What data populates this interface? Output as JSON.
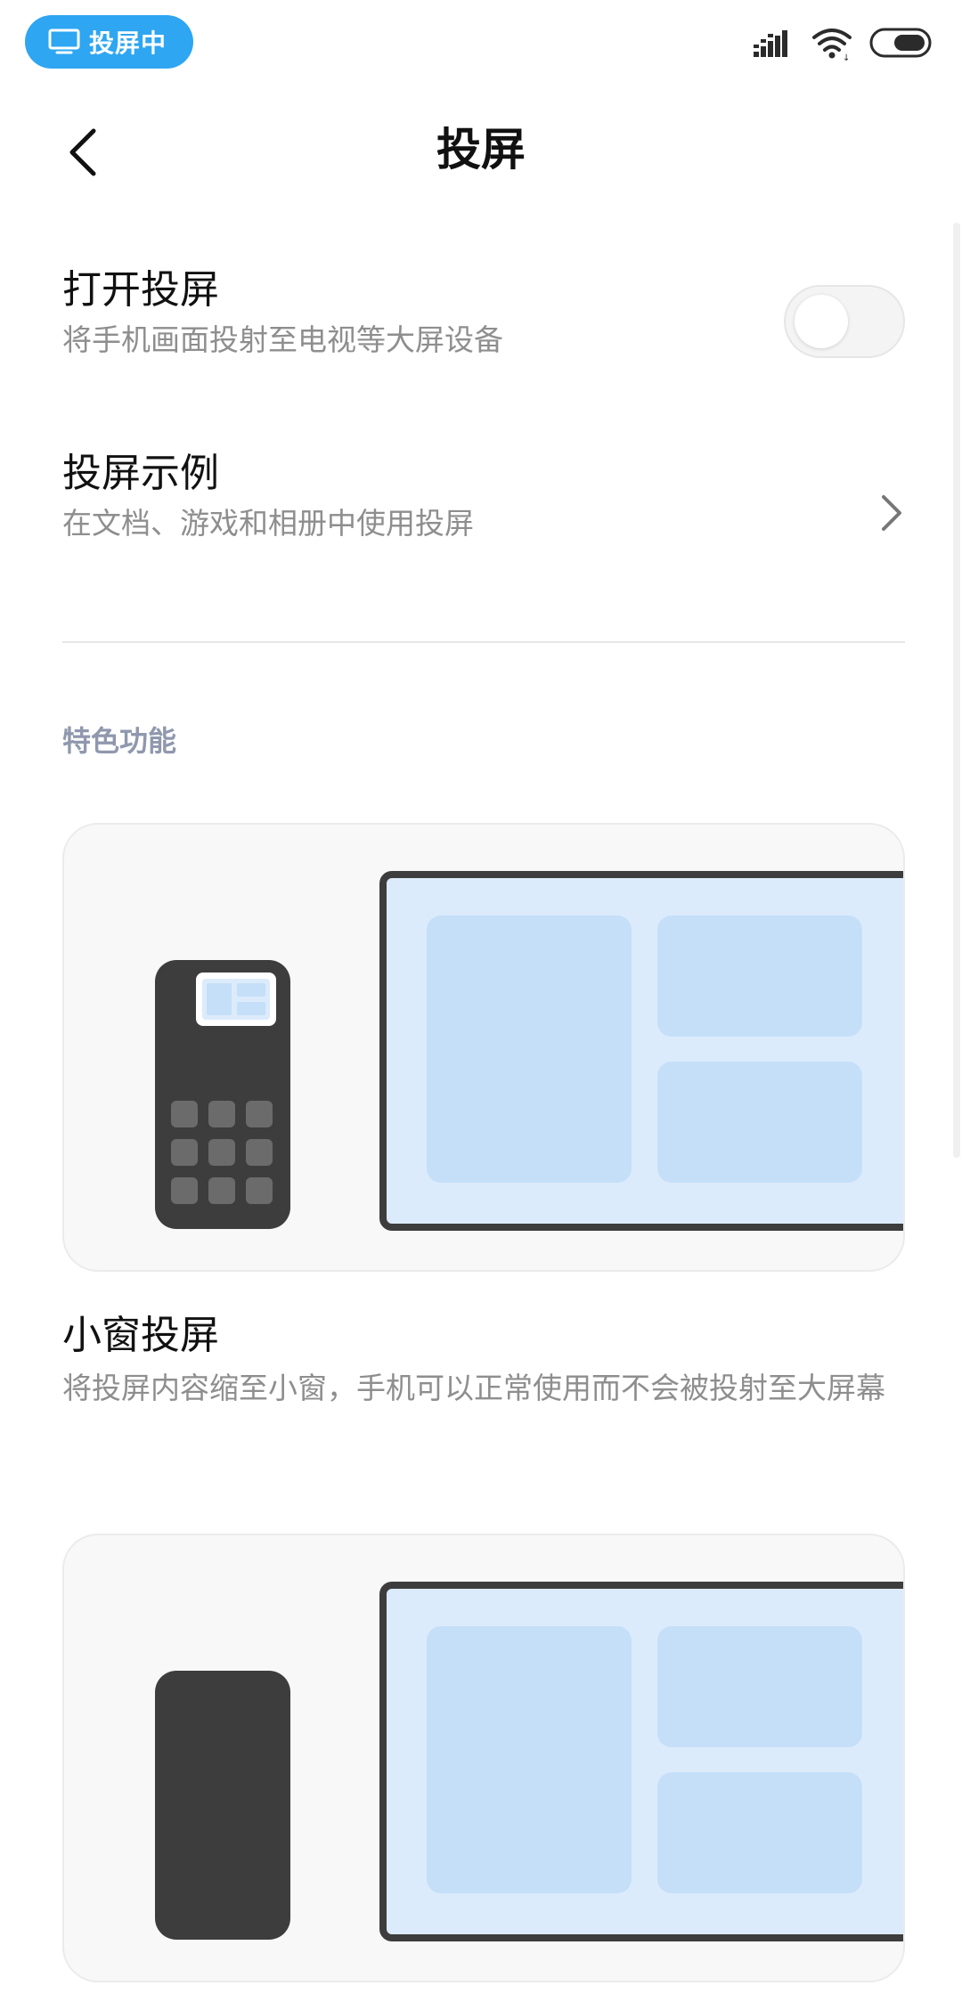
{
  "status_bar": {
    "cast_pill_label": "投屏中",
    "icons": [
      "monitor-icon",
      "signal-icon",
      "wifi-icon",
      "battery-icon"
    ]
  },
  "header": {
    "title": "投屏",
    "back_icon": "chevron-left-icon"
  },
  "settings": {
    "open_cast": {
      "title": "打开投屏",
      "subtitle": "将手机画面投射至电视等大屏设备",
      "toggle_on": false
    },
    "cast_examples": {
      "title": "投屏示例",
      "subtitle": "在文档、游戏和相册中使用投屏",
      "icon": "chevron-right-icon"
    }
  },
  "features": {
    "section_title": "特色功能",
    "items": [
      {
        "title": "小窗投屏",
        "description": "将投屏内容缩至小窗，手机可以正常使用而不会被投射至大屏幕",
        "illustration": "phone-small-window-to-tv"
      },
      {
        "illustration": "phone-to-tv"
      }
    ]
  },
  "colors": {
    "accent_blue": "#2ea6f1",
    "section_header": "#8f98ad",
    "tv_frame": "#3d3d3d",
    "tv_screen": "#dcebfb",
    "tv_tile": "#c5dff9",
    "phone_body": "#3d3d3d",
    "phone_app_icon": "#6b6b6b"
  }
}
